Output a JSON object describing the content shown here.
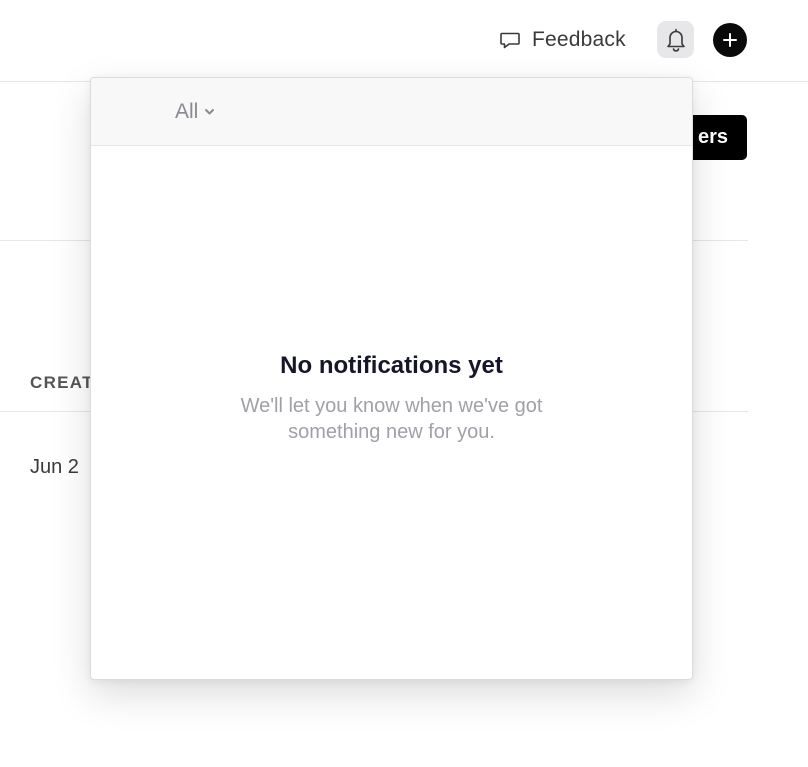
{
  "topbar": {
    "feedback_label": "Feedback",
    "feedback_icon": "speech-bubble-icon",
    "bell_icon": "bell-icon",
    "add_icon": "plus-icon"
  },
  "background": {
    "members_button_label": "ers",
    "column_header": "CREAT",
    "row_date": "Jun 2"
  },
  "notifications": {
    "filter": {
      "selected": "All",
      "icon": "chevron-down-icon"
    },
    "empty_title": "No notifications yet",
    "empty_message": "We'll let you know when we've got something new for you."
  },
  "colors": {
    "accent_dark": "#000000",
    "bell_button_bg": "#e7e7ea",
    "muted_text": "#a0a0a8",
    "title_text": "#15162a"
  }
}
